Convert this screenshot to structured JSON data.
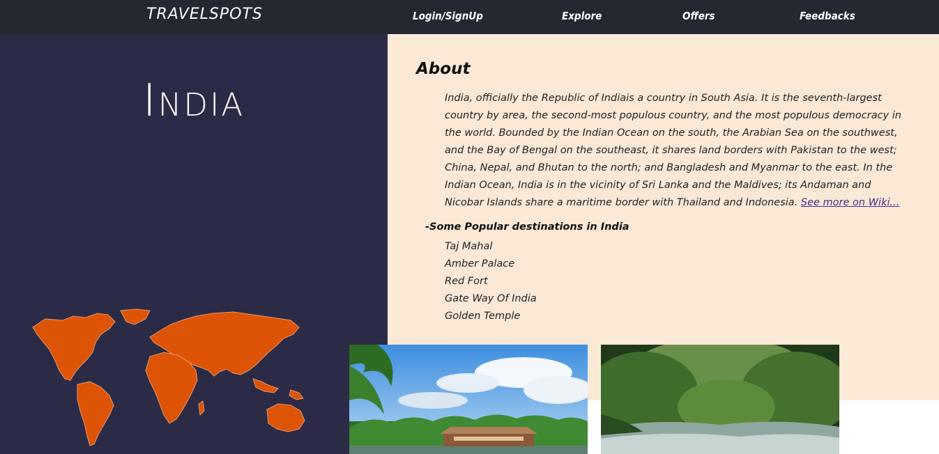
{
  "navbar": {
    "brand": "TRAVELSPOTS",
    "links": [
      "Login/SignUp",
      "Explore",
      "Offers",
      "Feedbacks"
    ]
  },
  "hero": {
    "country": "India"
  },
  "about": {
    "heading": "About",
    "text": "India, officially the Republic of Indiais a country in South Asia. It is the seventh-largest country by area, the second-most populous country, and the most populous democracy in the world. Bounded by the Indian Ocean on the south, the Arabian Sea on the southwest, and the Bay of Bengal on the southeast, it shares land borders with Pakistan to the west; China, Nepal, and Bhutan to the north; and Bangladesh and Myanmar to the east. In the Indian Ocean, India is in the vicinity of Sri Lanka and the Maldives; its Andaman and Nicobar Islands share a maritime border with Thailand and Indonesia.",
    "wiki_link": "See more on Wiki..."
  },
  "destinations": {
    "heading": "-Some Popular destinations in India",
    "items": [
      "Taj Mahal",
      "Amber Palace",
      "Red Fort",
      "Gate Way Of India",
      "Golden Temple"
    ]
  },
  "colors": {
    "navbar_bg": "#232831",
    "left_panel_bg": "#2b2a47",
    "content_bg": "#f9e9d6",
    "map_color": "#dd5305"
  },
  "icons": {
    "map": "world-map-icon"
  }
}
